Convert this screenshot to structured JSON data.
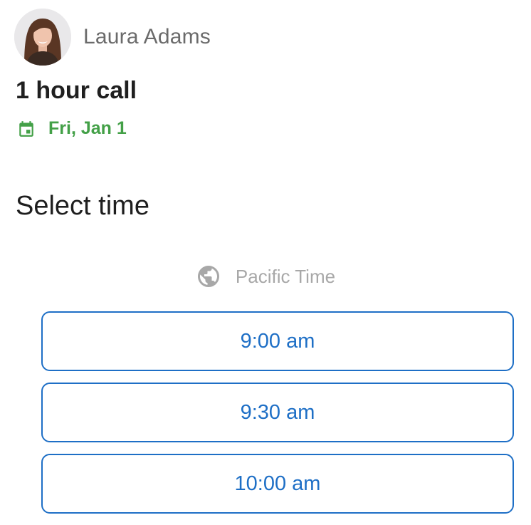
{
  "host": {
    "name": "Laura Adams"
  },
  "event": {
    "title": "1 hour call",
    "date": "Fri, Jan 1"
  },
  "section": {
    "title": "Select time"
  },
  "timezone": {
    "label": "Pacific Time",
    "icon": "globe-icon"
  },
  "slots": [
    {
      "label": "9:00 am"
    },
    {
      "label": "9:30 am"
    },
    {
      "label": "10:00 am"
    }
  ],
  "colors": {
    "accent": "#1e6fc6",
    "date_green": "#43a047",
    "muted": "#a8a8a8"
  }
}
